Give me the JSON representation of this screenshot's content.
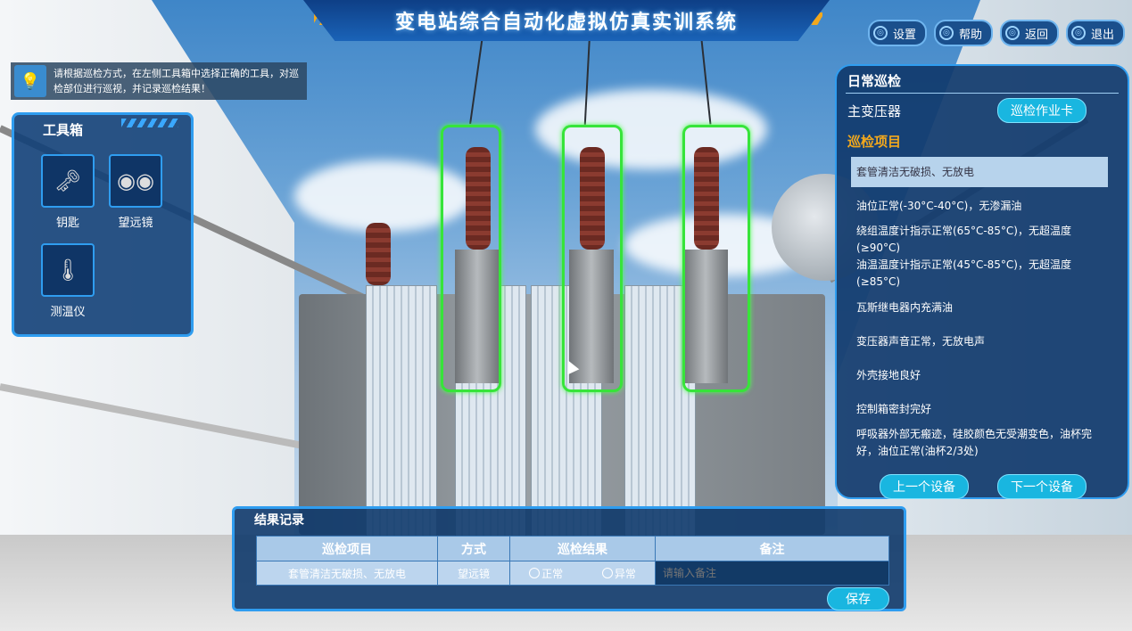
{
  "app": {
    "title": "变电站综合自动化虚拟仿真实训系统"
  },
  "top_buttons": [
    {
      "label": "设置",
      "icon": "gear-icon"
    },
    {
      "label": "帮助",
      "icon": "help-icon"
    },
    {
      "label": "返回",
      "icon": "back-icon"
    },
    {
      "label": "退出",
      "icon": "exit-icon"
    }
  ],
  "hint": {
    "text": "请根据巡检方式，在左侧工具箱中选择正确的工具，对巡检部位进行巡视，并记录巡检结果！",
    "icon": "lightbulb-icon"
  },
  "toolbox": {
    "title": "工具箱",
    "tools": [
      {
        "label": "钥匙",
        "icon": "key-icon"
      },
      {
        "label": "望远镜",
        "icon": "binoculars-icon"
      },
      {
        "label": "测温仪",
        "icon": "thermometer-icon"
      }
    ]
  },
  "inspection": {
    "title": "日常巡检",
    "device": "主变压器",
    "card_button": "巡检作业卡",
    "items_title": "巡检项目",
    "items": [
      "套管清洁无破损、无放电",
      "油位正常(-30°C-40°C)，无渗漏油",
      "绕组温度计指示正常(65°C-85°C)，无超温度(≥90°C)",
      "油温温度计指示正常(45°C-85°C)，无超温度(≥85°C)",
      "瓦斯继电器内充满油",
      "变压器声音正常，无放电声",
      "外壳接地良好",
      "控制箱密封完好",
      "呼吸器外部无瘢迹，硅胶颜色无受潮变色，油杯完好，油位正常(油杯2/3处)"
    ],
    "selected_index": 0,
    "prev_button": "上一个设备",
    "next_button": "下一个设备"
  },
  "result": {
    "title": "结果记录",
    "headers": [
      "巡检项目",
      "方式",
      "巡检结果",
      "备注"
    ],
    "row": {
      "item": "套管清洁无破损、无放电",
      "method": "望远镜",
      "option_normal": "正常",
      "option_abnormal": "异常",
      "note_placeholder": "请输入备注"
    },
    "save_button": "保存"
  },
  "colors": {
    "accent": "#2f9df0",
    "highlight": "#37e43a",
    "subtitle": "#f2a81d",
    "pill": "#19b6e0"
  }
}
